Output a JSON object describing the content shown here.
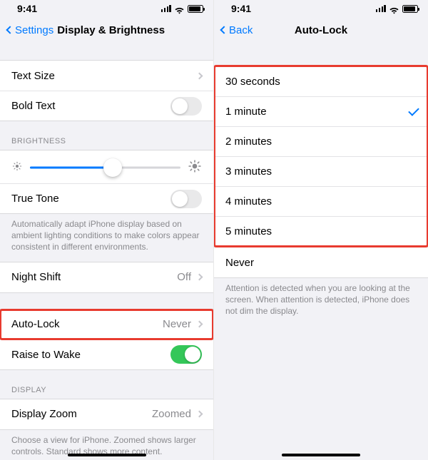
{
  "status": {
    "time": "9:41"
  },
  "left": {
    "nav": {
      "back_label": "Settings",
      "title": "Display & Brightness"
    },
    "rows": {
      "text_size": "Text Size",
      "bold_text": "Bold Text",
      "true_tone": "True Tone",
      "night_shift": "Night Shift",
      "night_shift_value": "Off",
      "auto_lock": "Auto-Lock",
      "auto_lock_value": "Never",
      "raise_to_wake": "Raise to Wake",
      "display_zoom": "Display Zoom",
      "display_zoom_value": "Zoomed"
    },
    "section_headers": {
      "brightness": "BRIGHTNESS",
      "display": "DISPLAY"
    },
    "footers": {
      "true_tone": "Automatically adapt iPhone display based on ambient lighting conditions to make colors appear consistent in different environments.",
      "display_zoom": "Choose a view for iPhone. Zoomed shows larger controls. Standard shows more content."
    },
    "slider": {
      "value_percent": 55
    },
    "toggles": {
      "bold_text": false,
      "true_tone": false,
      "raise_to_wake": true
    }
  },
  "right": {
    "nav": {
      "back_label": "Back",
      "title": "Auto-Lock"
    },
    "options": [
      {
        "label": "30 seconds",
        "selected": false
      },
      {
        "label": "1 minute",
        "selected": true
      },
      {
        "label": "2 minutes",
        "selected": false
      },
      {
        "label": "3 minutes",
        "selected": false
      },
      {
        "label": "4 minutes",
        "selected": false
      },
      {
        "label": "5 minutes",
        "selected": false
      }
    ],
    "never_label": "Never",
    "footer": "Attention is detected when you are looking at the screen. When attention is detected, iPhone does not dim the display."
  }
}
